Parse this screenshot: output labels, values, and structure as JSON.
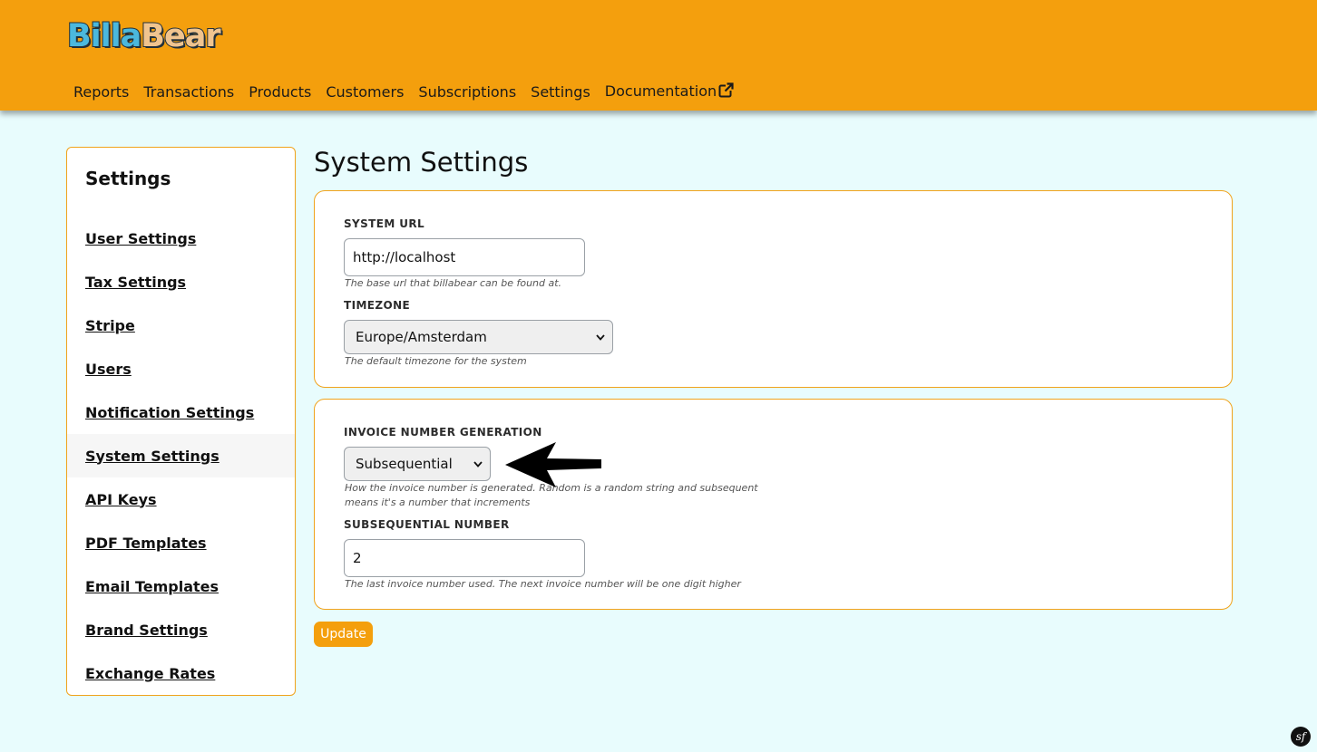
{
  "app": {
    "logo_part1": "Billa",
    "logo_part2": "Bear"
  },
  "nav": {
    "items": [
      {
        "label": "Reports"
      },
      {
        "label": "Transactions"
      },
      {
        "label": "Products"
      },
      {
        "label": "Customers"
      },
      {
        "label": "Subscriptions"
      },
      {
        "label": "Settings"
      },
      {
        "label": "Documentation",
        "icon": "external-link-icon"
      }
    ]
  },
  "sidebar": {
    "title": "Settings",
    "items": [
      {
        "label": "User Settings"
      },
      {
        "label": "Tax Settings"
      },
      {
        "label": "Stripe"
      },
      {
        "label": "Users"
      },
      {
        "label": "Notification Settings"
      },
      {
        "label": "System Settings",
        "active": true
      },
      {
        "label": "API Keys"
      },
      {
        "label": "PDF Templates"
      },
      {
        "label": "Email Templates"
      },
      {
        "label": "Brand Settings"
      },
      {
        "label": "Exchange Rates"
      }
    ]
  },
  "page": {
    "title": "System Settings"
  },
  "system": {
    "url_label": "SYSTEM URL",
    "url_value": "http://localhost",
    "url_help": "The base url that billabear can be found at.",
    "timezone_label": "TIMEZONE",
    "timezone_value": "Europe/Amsterdam",
    "timezone_help": "The default timezone for the system"
  },
  "invoice": {
    "generation_label": "INVOICE NUMBER GENERATION",
    "generation_value": "Subsequential",
    "generation_help_line1": "How the invoice number is generated. Random is a random string and subsequent",
    "generation_help_line2": "means it's a number that increments",
    "number_label": "SUBSEQUENTIAL NUMBER",
    "number_value": "2",
    "number_help": "The last invoice number used. The next invoice number will be one digit higher"
  },
  "actions": {
    "update_label": "Update"
  },
  "footer": {
    "framework_badge": "sf"
  },
  "colors": {
    "header": "#f49f0d",
    "page_background": "#e8fcfd",
    "card_border": "#f0a31c",
    "accent_button": "#f49f0d"
  },
  "icons": [
    "external-link-icon",
    "chevron-down-icon",
    "arrow-left-icon",
    "symfony-icon"
  ]
}
